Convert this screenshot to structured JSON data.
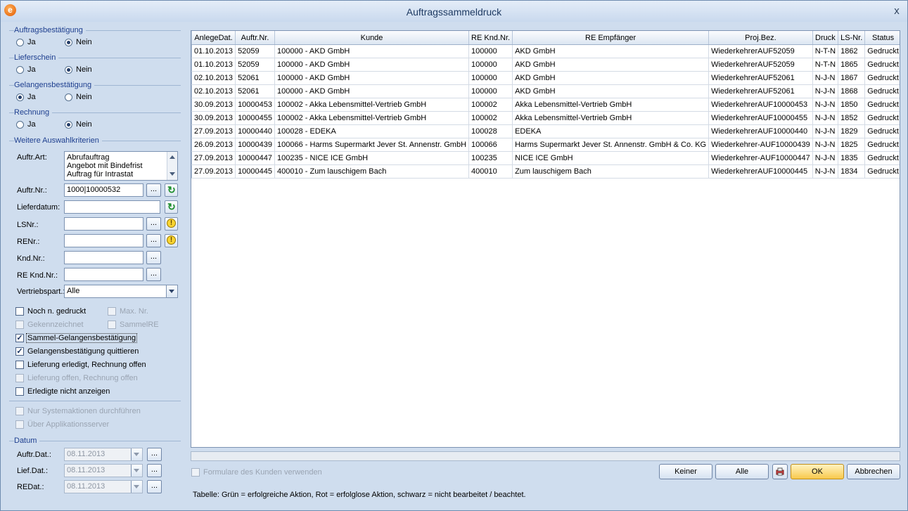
{
  "window": {
    "title": "Auftragssammeldruck",
    "close_glyph": "x",
    "app_icon": "e"
  },
  "left": {
    "auftragsbestaetigung": {
      "label": "Auftragsbestätigung",
      "ja": "Ja",
      "nein": "Nein",
      "selected": "Nein"
    },
    "lieferschein": {
      "label": "Lieferschein",
      "ja": "Ja",
      "nein": "Nein",
      "selected": "Nein"
    },
    "gelangensbestaetigung": {
      "label": "Gelangensbestätigung",
      "ja": "Ja",
      "nein": "Nein",
      "selected": "Ja"
    },
    "rechnung": {
      "label": "Rechnung",
      "ja": "Ja",
      "nein": "Nein",
      "selected": "Nein"
    },
    "weitere": {
      "label": "Weitere Auswahlkriterien"
    },
    "auftr_art": {
      "label": "Auftr.Art:",
      "items": [
        "Abrufauftrag",
        "Angebot mit Bindefrist",
        "Auftrag für Intrastat"
      ]
    },
    "auftr_nr": {
      "label": "Auftr.Nr.:",
      "value": "1000|10000532"
    },
    "lieferdatum": {
      "label": "Lieferdatum:",
      "value": ""
    },
    "lsnr": {
      "label": "LSNr.:",
      "value": ""
    },
    "renr": {
      "label": "RENr.:",
      "value": ""
    },
    "kndnr": {
      "label": "Knd.Nr.:",
      "value": ""
    },
    "rekndnr": {
      "label": "RE Knd.Nr.:",
      "value": ""
    },
    "vertriebspart": {
      "label": "Vertriebspart.:",
      "value": "Alle"
    },
    "dots": "...",
    "checks": {
      "noch_gedruckt": "Noch n. gedruckt",
      "max_nr": "Max. Nr.",
      "gekennzeichnet": "Gekennzeichnet",
      "sammelre": "SammelRE",
      "sammel_gelangens": "Sammel-Gelangensbestätigung",
      "gelangens_quittieren": "Gelangensbestätigung quittieren",
      "lieferung_erledigt": "Lieferung erledigt, Rechnung offen",
      "lieferung_offen": "Lieferung offen, Rechnung offen",
      "erledigte_nicht": "Erledigte nicht anzeigen",
      "nur_system": "Nur Systemaktionen durchführen",
      "ueber_app": "Über Applikationsserver",
      "check_mark": "✓"
    },
    "datum": {
      "label": "Datum",
      "auftr_label": "Auftr.Dat.:",
      "auftr_value": "08.11.2013",
      "lief_label": "Lief.Dat.:",
      "lief_value": "08.11.2013",
      "re_label": "REDat.:",
      "re_value": "08.11.2013"
    }
  },
  "table": {
    "headers": [
      "AnlegeDat.",
      "Auftr.Nr.",
      "Kunde",
      "RE Knd.Nr.",
      "RE Empfänger",
      "Proj.Bez.",
      "Druck",
      "LS-Nr.",
      "Status"
    ],
    "rows": [
      [
        "01.10.2013",
        "52059",
        "100000 - AKD GmbH",
        "100000",
        "AKD GmbH",
        "WiederkehrerAUF52059",
        "N-T-N",
        "1862",
        "Gedruckt"
      ],
      [
        "01.10.2013",
        "52059",
        "100000 - AKD GmbH",
        "100000",
        "AKD GmbH",
        "WiederkehrerAUF52059",
        "N-T-N",
        "1865",
        "Gedruckt"
      ],
      [
        "02.10.2013",
        "52061",
        "100000 - AKD GmbH",
        "100000",
        "AKD GmbH",
        "WiederkehrerAUF52061",
        "N-J-N",
        "1867",
        "Gedruckt"
      ],
      [
        "02.10.2013",
        "52061",
        "100000 - AKD GmbH",
        "100000",
        "AKD GmbH",
        "WiederkehrerAUF52061",
        "N-J-N",
        "1868",
        "Gedruckt"
      ],
      [
        "30.09.2013",
        "10000453",
        "100002 - Akka Lebensmittel-Vertrieb GmbH",
        "100002",
        "Akka Lebensmittel-Vertrieb GmbH",
        "WiederkehrerAUF10000453",
        "N-J-N",
        "1850",
        "Gedruckt"
      ],
      [
        "30.09.2013",
        "10000455",
        "100002 - Akka Lebensmittel-Vertrieb GmbH",
        "100002",
        "Akka Lebensmittel-Vertrieb GmbH",
        "WiederkehrerAUF10000455",
        "N-J-N",
        "1852",
        "Gedruckt"
      ],
      [
        "27.09.2013",
        "10000440",
        "100028 - EDEKA",
        "100028",
        "EDEKA",
        "WiederkehrerAUF10000440",
        "N-J-N",
        "1829",
        "Gedruckt"
      ],
      [
        "26.09.2013",
        "10000439",
        "100066 - Harms Supermarkt Jever St. Annenstr. GmbH",
        "100066",
        "Harms Supermarkt Jever St. Annenstr. GmbH & Co. KG",
        "Wiederkehrer-AUF10000439",
        "N-J-N",
        "1825",
        "Gedruckt"
      ],
      [
        "27.09.2013",
        "10000447",
        "100235 - NICE ICE GmbH",
        "100235",
        "NICE ICE GmbH",
        "Wiederkehrer-AUF10000447",
        "N-J-N",
        "1835",
        "Gedruckt"
      ],
      [
        "27.09.2013",
        "10000445",
        "400010 - Zum lauschigem Bach",
        "400010",
        "Zum lauschigem Bach",
        "WiederkehrerAUF10000445",
        "N-J-N",
        "1834",
        "Gedruckt"
      ]
    ]
  },
  "bottom": {
    "formulare": "Formulare des Kunden verwenden",
    "keiner": "Keiner",
    "alle": "Alle",
    "ok": "OK",
    "abbrechen": "Abbrechen",
    "legend": "Tabelle: Grün = erfolgreiche Aktion, Rot = erfolglose Aktion, schwarz = nicht bearbeitet / beachtet."
  }
}
